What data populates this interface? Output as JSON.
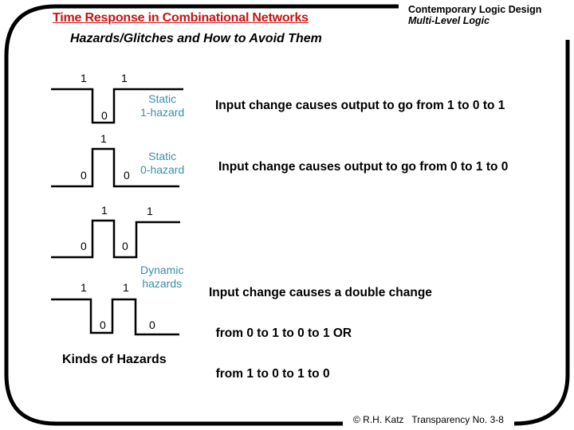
{
  "header": {
    "title": "Time Response in Combinational Networks",
    "subtitle": "Hazards/Glitches and How to Avoid Them",
    "course": "Contemporary Logic Design",
    "topic": "Multi-Level Logic"
  },
  "colors": {
    "title": "#cc1111",
    "hazard_label": "#3a8fa6",
    "frame": "#000000"
  },
  "waveforms": [
    {
      "name": "static-1-hazard",
      "label_lines": [
        "Static",
        "1-hazard"
      ],
      "levels": [
        "1",
        "0",
        "1"
      ],
      "description": "Input change causes output to go from 1 to 0 to 1"
    },
    {
      "name": "static-0-hazard",
      "label_lines": [
        "Static",
        "0-hazard"
      ],
      "levels": [
        "0",
        "1",
        "0"
      ],
      "description": "Input change causes output to go from 0 to 1 to 0"
    },
    {
      "name": "dynamic-hazard-rising",
      "levels": [
        "0",
        "1",
        "0",
        "1"
      ]
    },
    {
      "name": "dynamic-hazard-falling",
      "levels": [
        "1",
        "0",
        "1",
        "0"
      ]
    }
  ],
  "dynamic": {
    "label_lines": [
      "Dynamic",
      "hazards"
    ],
    "description_lines": [
      "Input change causes a double change",
      "  from 0 to 1 to 0 to 1 OR",
      "  from 1 to 0 to 1 to 0"
    ]
  },
  "caption": "Kinds of Hazards",
  "footer": {
    "copyright": "© R.H. Katz",
    "transparency": "Transparency No. 3-8"
  }
}
